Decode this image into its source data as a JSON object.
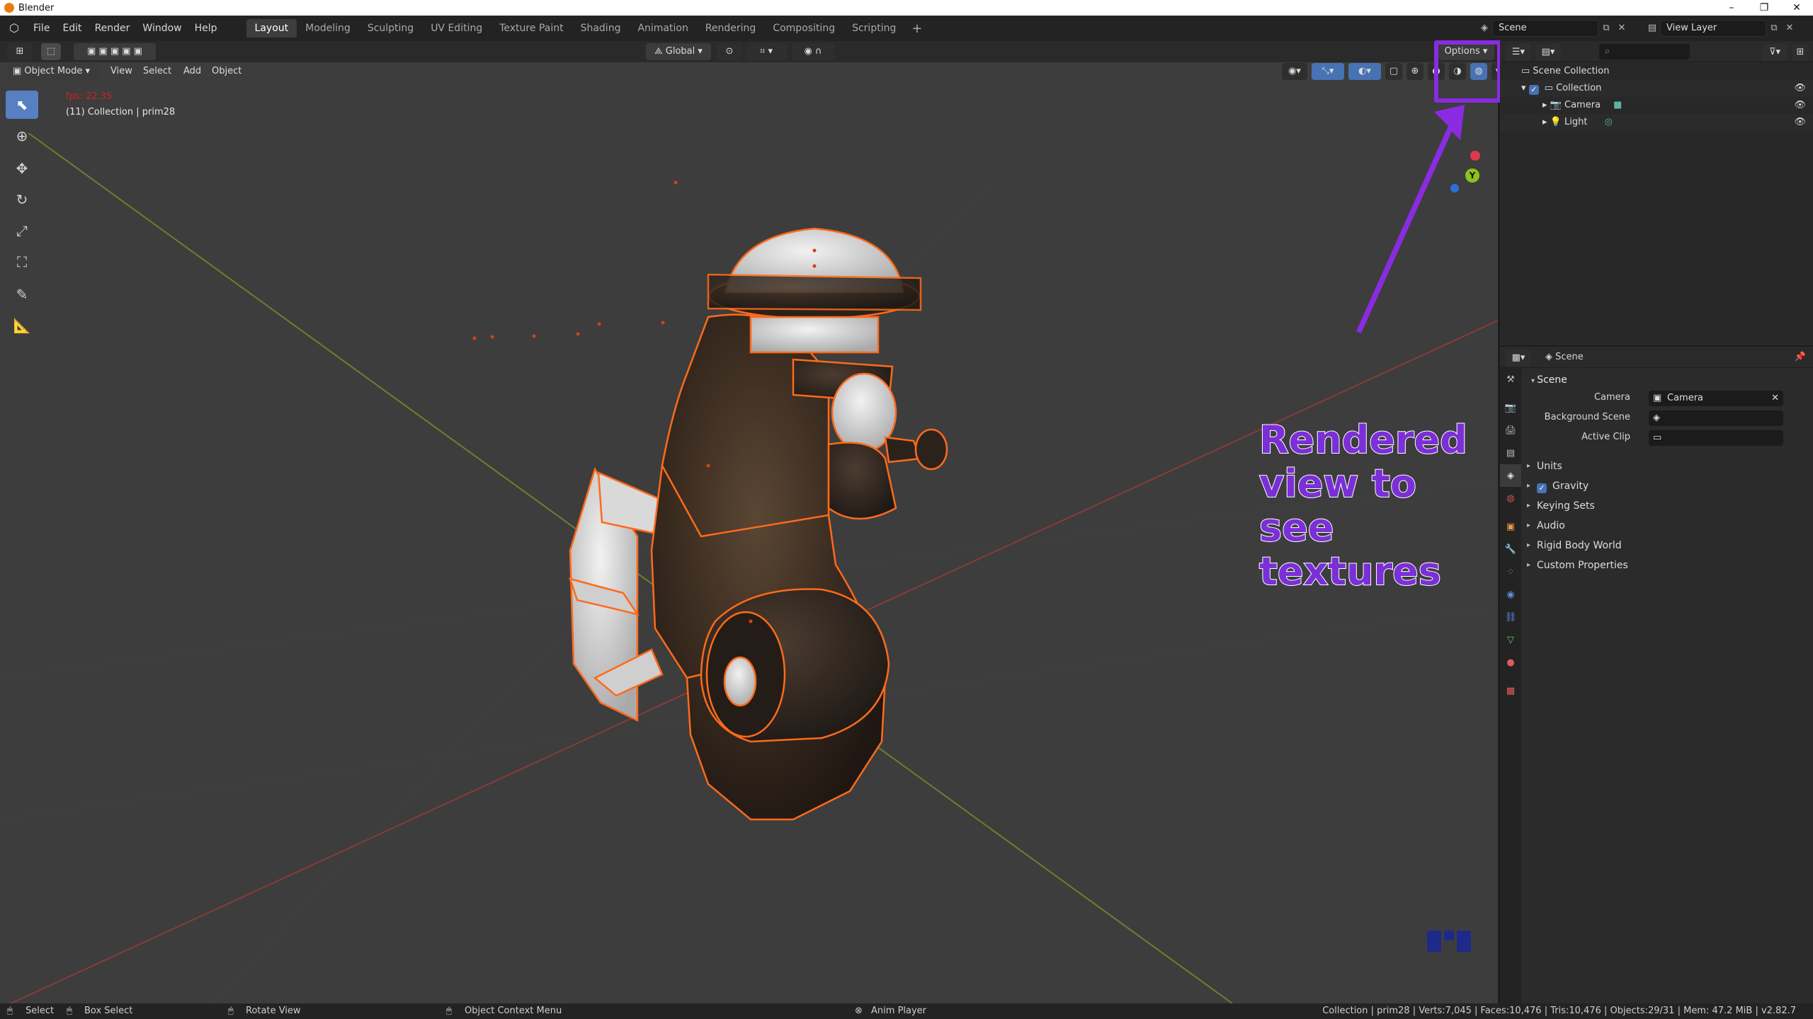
{
  "window": {
    "title": "Blender",
    "controls": [
      "–",
      "❐",
      "✕"
    ]
  },
  "menu": {
    "items": [
      "File",
      "Edit",
      "Render",
      "Window",
      "Help"
    ]
  },
  "workspaces": {
    "tabs": [
      "Layout",
      "Modeling",
      "Sculpting",
      "UV Editing",
      "Texture Paint",
      "Shading",
      "Animation",
      "Rendering",
      "Compositing",
      "Scripting"
    ],
    "active": "Layout",
    "add_label": "+"
  },
  "scene_selector": {
    "scene": "Scene",
    "view_layer": "View Layer"
  },
  "viewport_header": {
    "transform_orientation": "Global",
    "options_label": "Options",
    "mode": "Object Mode",
    "menus": [
      "View",
      "Select",
      "Add",
      "Object"
    ]
  },
  "viewport": {
    "fps": "fps: 22.35",
    "collection_info": "(11) Collection | prim28",
    "gizmo_y_label": "Y"
  },
  "annotation": {
    "lines": [
      "Rendered",
      "view to see",
      "textures"
    ],
    "color": "#7b2fd6"
  },
  "outliner": {
    "search_placeholder": "",
    "rows": [
      {
        "label": "Scene Collection"
      },
      {
        "label": "Collection"
      },
      {
        "label": "Camera"
      },
      {
        "label": "Light"
      }
    ]
  },
  "properties": {
    "context": "Scene",
    "panel_title": "Scene",
    "camera_label": "Camera",
    "camera_value": "Camera",
    "background_scene_label": "Background Scene",
    "background_scene_value": "",
    "active_clip_label": "Active Clip",
    "active_clip_value": "",
    "subpanels": [
      "Units",
      "Gravity",
      "Keying Sets",
      "Audio",
      "Rigid Body World",
      "Custom Properties"
    ],
    "gravity_checked": true
  },
  "statusbar": {
    "select": "Select",
    "box_select": "Box Select",
    "rotate_view": "Rotate View",
    "context_menu": "Object Context Menu",
    "anim_player": "Anim Player",
    "stats": "Collection | prim28 | Verts:7,045 | Faces:10,476 | Tris:10,476 | Objects:29/31 | Mem: 47.2 MiB | v2.82.7"
  }
}
